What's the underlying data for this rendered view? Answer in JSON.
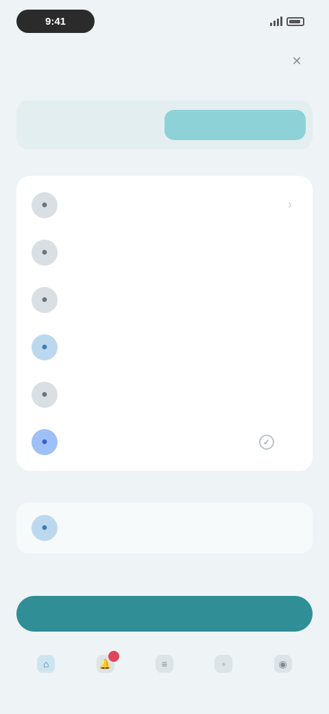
{
  "status_bar": {
    "time": "9:41",
    "icons": [
      "signal-icon",
      "wifi-icon",
      "battery-icon"
    ]
  },
  "header": {
    "title": "",
    "action_icon": "close-icon"
  },
  "segments": [
    {
      "label": "",
      "active": false
    },
    {
      "label": "",
      "active": true
    }
  ],
  "section_label": "",
  "list": [
    {
      "icon": "circle-icon",
      "title": "",
      "subtitle": ""
    },
    {
      "icon": "circle-icon",
      "title": "",
      "subtitle": ""
    },
    {
      "icon": "circle-icon",
      "title": "",
      "subtitle": ""
    },
    {
      "icon": "circle-icon",
      "title": "",
      "subtitle": ""
    },
    {
      "icon": "circle-icon",
      "title": "",
      "subtitle": ""
    },
    {
      "icon": "circle-icon",
      "title": "",
      "subtitle": "",
      "checked": true
    }
  ],
  "secondary_item": {
    "icon": "circle-icon",
    "title": "",
    "subtitle": ""
  },
  "primary_button": {
    "label": ""
  },
  "tabs": [
    {
      "label": "",
      "icon": "home-icon",
      "active": true
    },
    {
      "label": "",
      "icon": "bell-icon",
      "badge": ""
    },
    {
      "label": "",
      "icon": "list-icon"
    },
    {
      "label": "",
      "icon": "chat-icon"
    },
    {
      "label": "",
      "icon": "user-icon"
    }
  ],
  "colors": {
    "accent": "#2f8e96",
    "segment_active": "#8dd2d6",
    "badge": "#e0445a"
  }
}
